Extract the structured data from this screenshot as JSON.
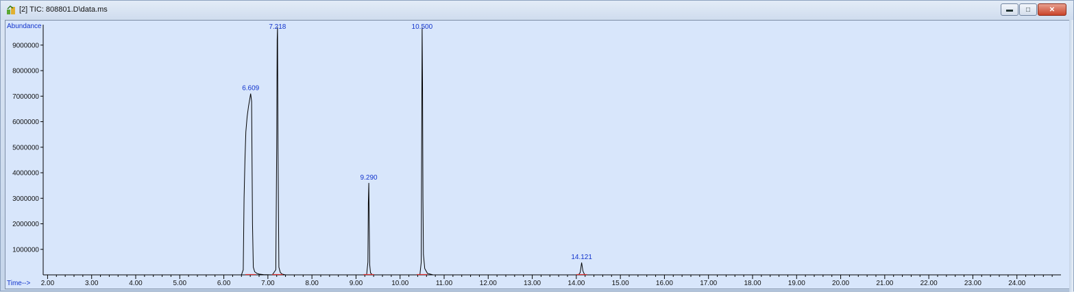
{
  "window": {
    "title": "[2] TIC: 808801.D\\data.ms",
    "buttons": {
      "minimize": "▬",
      "maximize": "□",
      "close": "✕"
    }
  },
  "chart_data": {
    "type": "line",
    "ylabel": "Abundance",
    "xlabel": "Time-->",
    "xlim": [
      1.9,
      25.0
    ],
    "ylim": [
      0,
      9800000
    ],
    "x_ticks": [
      2.0,
      3.0,
      4.0,
      5.0,
      6.0,
      7.0,
      8.0,
      9.0,
      10.0,
      11.0,
      12.0,
      13.0,
      14.0,
      15.0,
      16.0,
      17.0,
      18.0,
      19.0,
      20.0,
      21.0,
      22.0,
      23.0,
      24.0
    ],
    "x_tick_labels": [
      "2.00",
      "3.00",
      "4.00",
      "5.00",
      "6.00",
      "7.00",
      "8.00",
      "9.00",
      "10.00",
      "11.00",
      "12.00",
      "13.00",
      "14.00",
      "15.00",
      "16.00",
      "17.00",
      "18.00",
      "19.00",
      "20.00",
      "21.00",
      "22.00",
      "23.00",
      "24.00"
    ],
    "y_ticks": [
      1000000,
      2000000,
      3000000,
      4000000,
      5000000,
      6000000,
      7000000,
      8000000,
      9000000
    ],
    "y_tick_labels": [
      "1000000",
      "2000000",
      "3000000",
      "4000000",
      "5000000",
      "6000000",
      "7000000",
      "8000000",
      "9000000"
    ],
    "grid": false,
    "peaks": [
      {
        "rt": 6.609,
        "label": "6.609",
        "apex": 7100000
      },
      {
        "rt": 7.218,
        "label": "7.218",
        "apex": 9700000
      },
      {
        "rt": 9.29,
        "label": "9.290",
        "apex": 3600000
      },
      {
        "rt": 10.5,
        "label": "10.500",
        "apex": 9700000
      },
      {
        "rt": 14.121,
        "label": "14.121",
        "apex": 480000
      }
    ],
    "series": [
      {
        "color": "#000000",
        "x": [
          1.9,
          6.4,
          6.44,
          6.46,
          6.48,
          6.5,
          6.53,
          6.56,
          6.59,
          6.609,
          6.63,
          6.65,
          6.67,
          6.7,
          6.75,
          6.8,
          6.9,
          7.1,
          7.18,
          7.2,
          7.21,
          7.218,
          7.23,
          7.25,
          7.28,
          7.32,
          7.4,
          9.24,
          9.27,
          9.28,
          9.29,
          9.3,
          9.31,
          9.33,
          9.37,
          10.45,
          10.48,
          10.49,
          10.5,
          10.51,
          10.52,
          10.53,
          10.56,
          10.62,
          10.75,
          14.05,
          14.09,
          14.121,
          14.15,
          14.19,
          25.0
        ],
        "y": [
          0,
          0,
          200000,
          3000000,
          4500000,
          5600000,
          6200000,
          6600000,
          6900000,
          7100000,
          6800000,
          2000000,
          300000,
          120000,
          60000,
          30000,
          10000,
          0,
          200000,
          5000000,
          9200000,
          9700000,
          5000000,
          300000,
          100000,
          30000,
          0,
          0,
          500000,
          2800000,
          3600000,
          2000000,
          400000,
          80000,
          0,
          0,
          500000,
          5000000,
          9700000,
          7500000,
          3000000,
          800000,
          250000,
          60000,
          0,
          0,
          100000,
          480000,
          150000,
          0,
          0
        ]
      }
    ]
  }
}
